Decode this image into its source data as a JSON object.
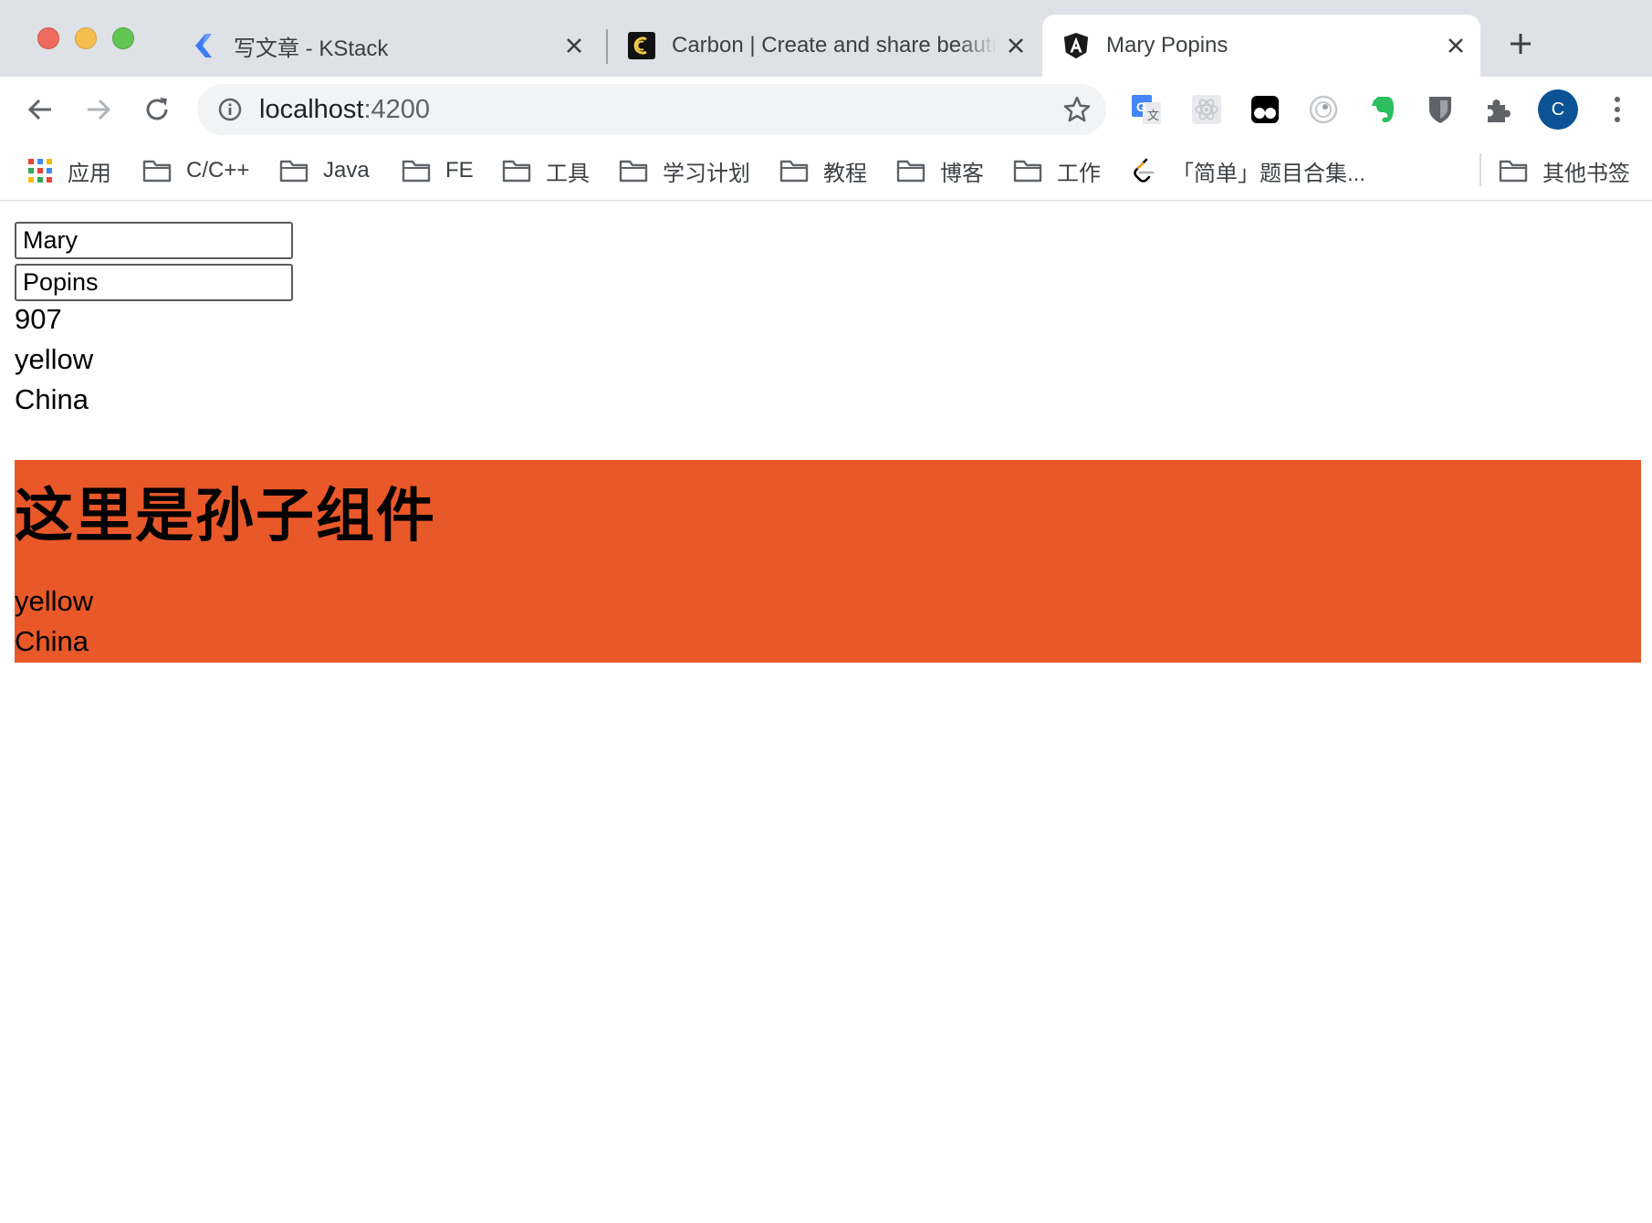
{
  "browser": {
    "tabs": [
      {
        "title": "写文章 - KStack",
        "icon": "kstack-logo-icon",
        "active": false
      },
      {
        "title": "Carbon | Create and share beautiful images of your source code",
        "icon": "carbon-logo-icon",
        "active": false
      },
      {
        "title": "Mary Popins",
        "icon": "angular-logo-icon",
        "active": true
      }
    ],
    "new_tab_icon": "plus-icon",
    "address": {
      "host": "localhost",
      "port": ":4200"
    },
    "avatar_letter": "C",
    "extensions": [
      "google-translate-icon",
      "react-devtools-icon",
      "tampermonkey-icon",
      "extension-circle-icon",
      "evernote-icon",
      "bitwarden-icon",
      "extensions-puzzle-icon"
    ],
    "colors": {
      "tab_strip": "#dee1e6",
      "accent_avatar": "#0b5394"
    }
  },
  "bookmarks": {
    "apps": "应用",
    "folders": [
      "C/C++",
      "Java",
      "FE",
      "工具",
      "学习计划",
      "教程",
      "博客",
      "工作"
    ],
    "leetcode": "「简单」题目合集...",
    "other": "其他书签"
  },
  "page": {
    "first_name": "Mary",
    "last_name": "Popins",
    "number": "907",
    "color": "yellow",
    "country": "China",
    "grandchild": {
      "heading": "这里是孙子组件",
      "color": "yellow",
      "country": "China",
      "background": "#e95828"
    }
  }
}
